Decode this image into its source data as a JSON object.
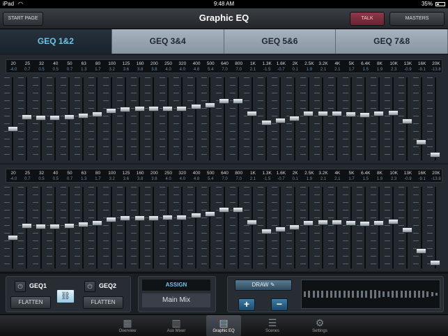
{
  "status": {
    "carrier": "iPad",
    "time": "9:48 AM",
    "battery": "35%"
  },
  "header": {
    "start_page": "START PAGE",
    "title": "Graphic EQ",
    "talk": "TALK",
    "masters": "MASTERS"
  },
  "tabs": [
    {
      "label": "GEQ 1&2",
      "active": true
    },
    {
      "label": "GEQ 3&4",
      "active": false
    },
    {
      "label": "GEQ 5&6",
      "active": false
    },
    {
      "label": "GEQ 7&8",
      "active": false
    }
  ],
  "eq_bands": {
    "freqs": [
      "20",
      "25",
      "32",
      "40",
      "50",
      "63",
      "80",
      "100",
      "125",
      "160",
      "200",
      "250",
      "320",
      "400",
      "500",
      "640",
      "800",
      "1K",
      "1.3K",
      "1.6K",
      "2K",
      "2.5K",
      "3.2K",
      "4K",
      "5K",
      "6.4K",
      "8K",
      "10K",
      "13K",
      "16K",
      "20K"
    ],
    "gains": [
      "-4.0",
      "0.7",
      "0.5",
      "0.5",
      "0.7",
      "1.3",
      "1.7",
      "3.2",
      "3.6",
      "3.8",
      "3.8",
      "4.0",
      "4.0",
      "4.8",
      "5.4",
      "7.0",
      "7.0",
      "2.1",
      "-1.5",
      "-0.7",
      "0.1",
      "1.9",
      "2.1",
      "2.1",
      "1.7",
      "1.5",
      "1.9",
      "2.3",
      "-0.9",
      "-9.1",
      "-13.8"
    ]
  },
  "geq": [
    {
      "name": "GEQ 1",
      "label": "GEQ1",
      "flatten": "FLATTEN",
      "gains": [
        -4.0,
        0.7,
        0.5,
        0.5,
        0.7,
        1.3,
        1.7,
        3.2,
        3.6,
        3.8,
        3.8,
        4.0,
        4.0,
        4.8,
        5.4,
        7.0,
        7.0,
        2.1,
        -1.5,
        -0.7,
        0.1,
        1.9,
        2.1,
        2.1,
        1.7,
        1.5,
        1.9,
        2.3,
        -0.9,
        -9.1,
        -13.8
      ]
    },
    {
      "name": "GEQ 2",
      "label": "GEQ2",
      "flatten": "FLATTEN",
      "gains": [
        -4.0,
        0.7,
        0.5,
        0.5,
        0.7,
        1.3,
        1.7,
        3.2,
        3.6,
        3.8,
        3.8,
        4.0,
        4.0,
        4.8,
        5.4,
        7.0,
        7.0,
        2.1,
        -1.5,
        -0.7,
        0.1,
        1.9,
        2.1,
        2.1,
        1.7,
        1.5,
        1.9,
        2.3,
        -0.9,
        -9.1,
        -13.8
      ]
    }
  ],
  "assign": {
    "label": "ASSIGN",
    "target": "Main Mix"
  },
  "draw": {
    "label": "DRAW",
    "plus": "+",
    "minus": "−"
  },
  "nav": [
    {
      "label": "Overview",
      "icon": "overview-icon",
      "active": false
    },
    {
      "label": "Aux Mixer",
      "icon": "aux-mixer-icon",
      "active": false
    },
    {
      "label": "Graphic EQ",
      "icon": "graphic-eq-icon",
      "active": true
    },
    {
      "label": "Scenes",
      "icon": "scenes-icon",
      "active": false
    },
    {
      "label": "Settings",
      "icon": "settings-icon",
      "active": false
    }
  ],
  "colors": {
    "accent": "#6fc3e6",
    "talk": "#8e3a4a",
    "tab_inactive": "#98a4b0"
  }
}
